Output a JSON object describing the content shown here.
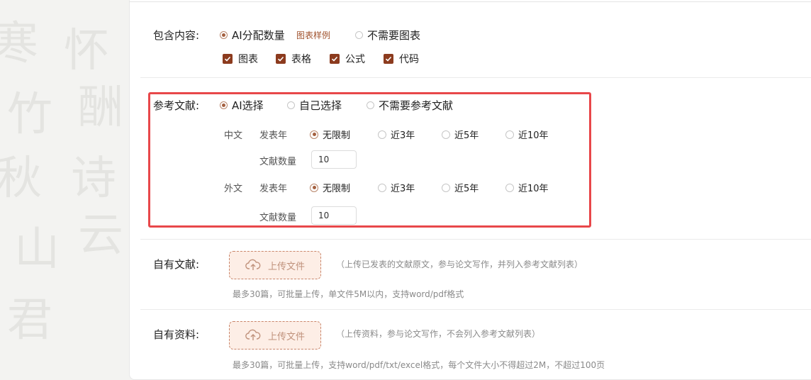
{
  "content_section": {
    "label": "包含内容:",
    "radio_ai": "AI分配数量",
    "sample_link": "图表样例",
    "radio_none": "不需要图表",
    "checkboxes": [
      "图表",
      "表格",
      "公式",
      "代码"
    ]
  },
  "references": {
    "label": "参考文献:",
    "options": [
      "AI选择",
      "自己选择",
      "不需要参考文献"
    ],
    "chinese": {
      "label": "中文",
      "year_label": "发表年",
      "year_options": [
        "无限制",
        "近3年",
        "近5年",
        "近10年"
      ],
      "count_label": "文献数量",
      "count_value": "10"
    },
    "foreign": {
      "label": "外文",
      "year_label": "发表年",
      "year_options": [
        "无限制",
        "近3年",
        "近5年",
        "近10年"
      ],
      "count_label": "文献数量",
      "count_value": "10"
    }
  },
  "own_refs": {
    "label": "自有文献:",
    "upload_label": "上传文件",
    "hint": "（上传已发表的文献原文，参与论文写作，并列入参考文献列表）",
    "limit": "最多30篇，可批量上传，单文件5M以内，支持word/pdf格式"
  },
  "own_materials": {
    "label": "自有资料:",
    "upload_label": "上传文件",
    "hint": "（上传资料，参与论文写作，不会列入参考文献列表）",
    "limit": "最多30篇，可批量上传，支持word/pdf/txt/excel格式，每个文件大小不得超过2M，不超过100页"
  },
  "colors": {
    "accent": "#8c3b1e",
    "highlight_border": "#e8474a",
    "upload_bg": "#fdeee6"
  },
  "icons": {
    "checkbox_checked": "check-icon",
    "upload": "cloud-upload-icon"
  }
}
